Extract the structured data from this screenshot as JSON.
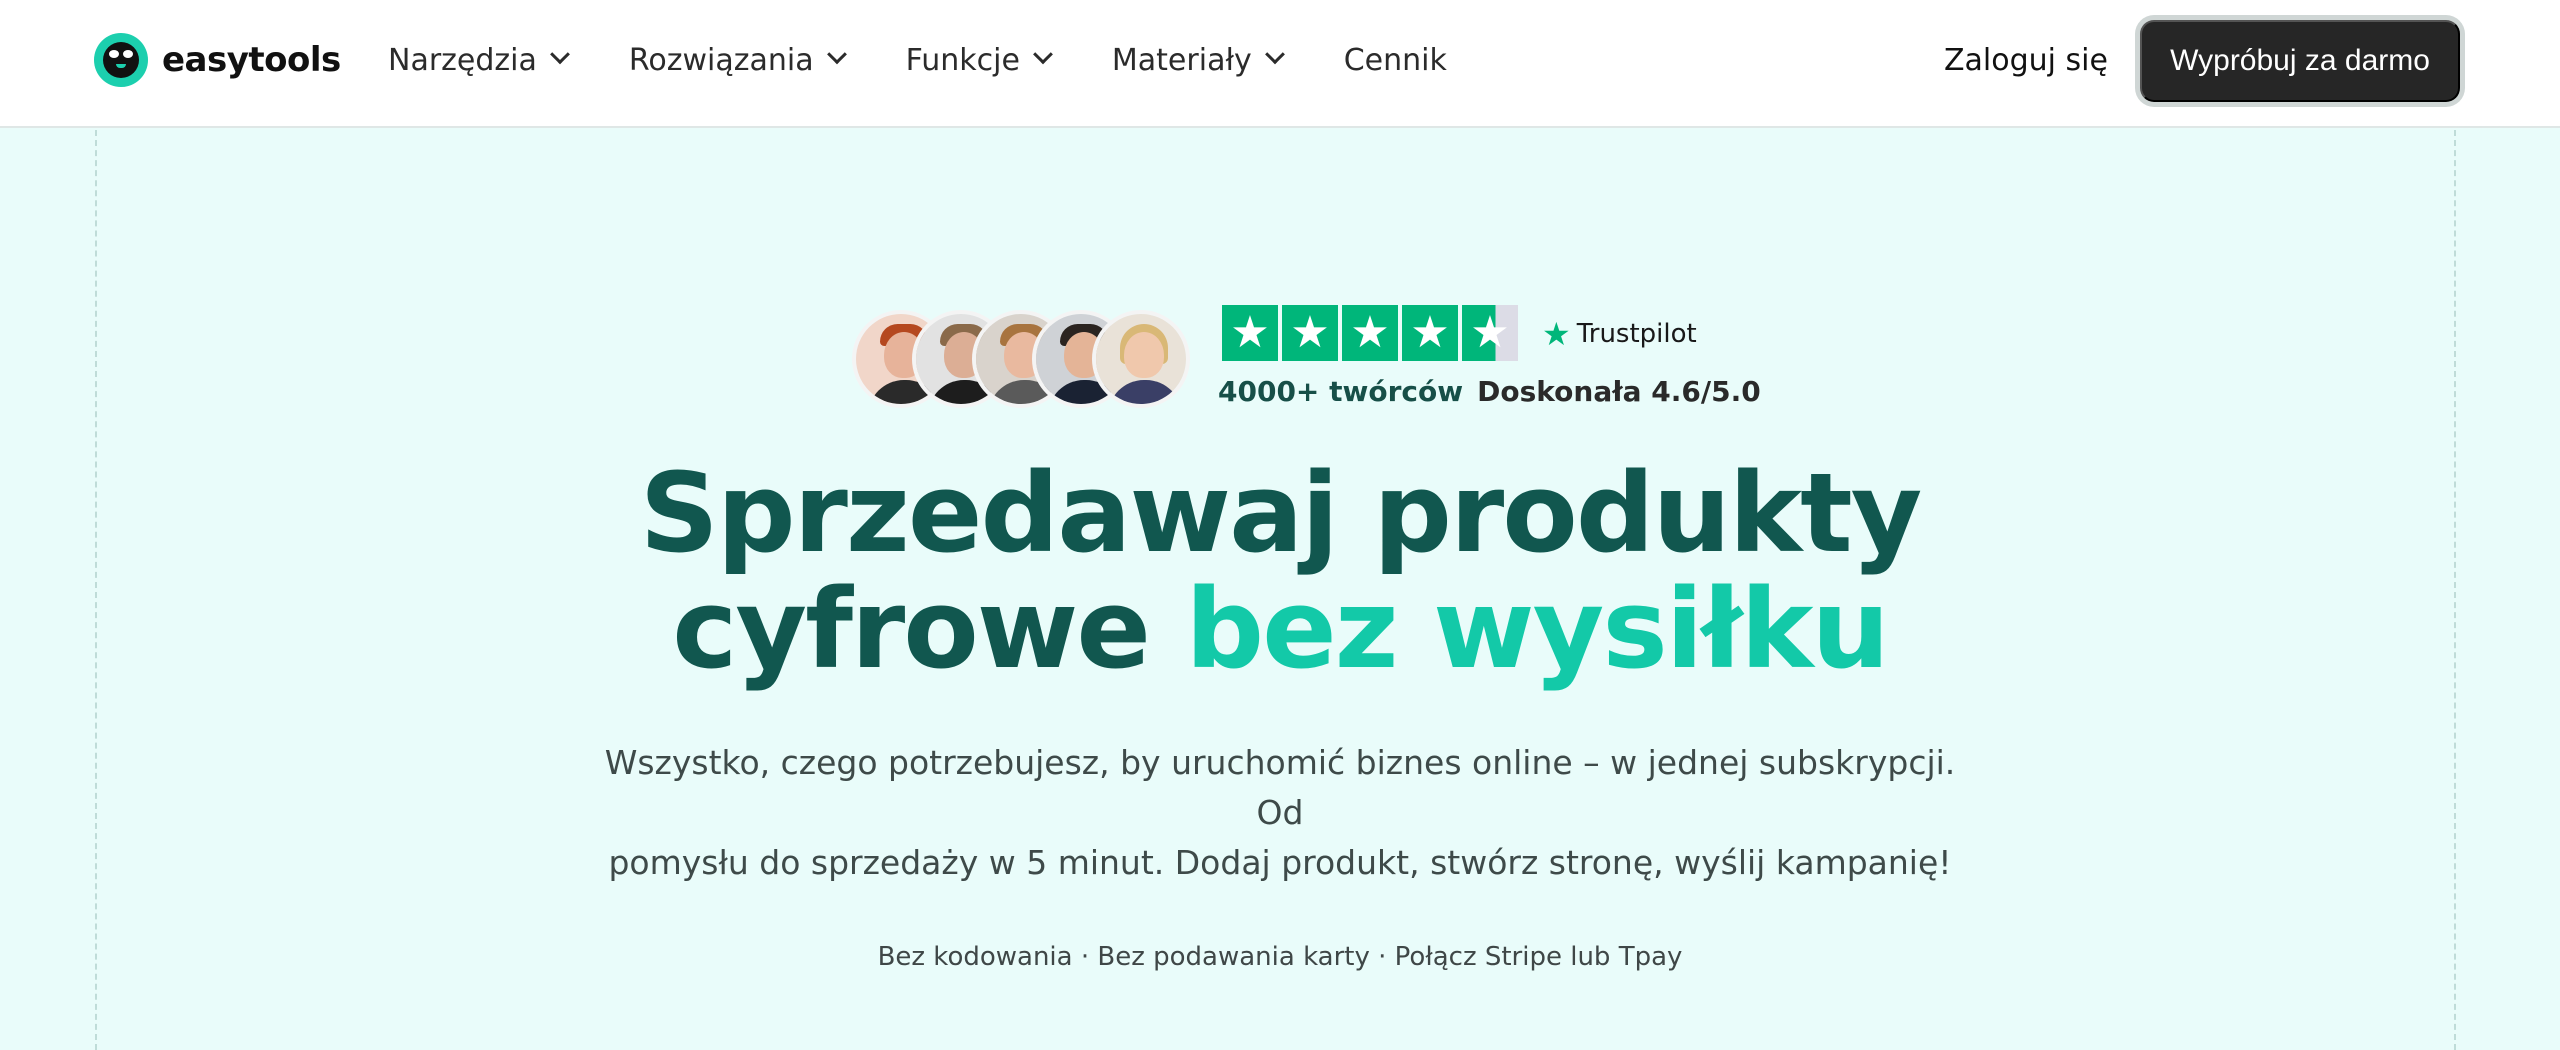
{
  "brand": {
    "name": "easytools"
  },
  "nav": {
    "items": [
      {
        "label": "Narzędzia",
        "has_dropdown": true
      },
      {
        "label": "Rozwiązania",
        "has_dropdown": true
      },
      {
        "label": "Funkcje",
        "has_dropdown": true
      },
      {
        "label": "Materiały",
        "has_dropdown": true
      },
      {
        "label": "Cennik",
        "has_dropdown": false
      }
    ],
    "login_label": "Zaloguj się",
    "cta_label": "Wypróbuj za darmo"
  },
  "proof": {
    "avatar_count": 5,
    "star_rating": 4.6,
    "star_max": 5,
    "trustpilot_label": "Trustpilot",
    "creators_text": "4000+ twórców",
    "rating_text": "Doskonała 4.6/5.0"
  },
  "hero": {
    "headline_line1": "Sprzedawaj produkty",
    "headline_line2_plain": "cyfrowe",
    "headline_line2_accent": "bez wysiłku",
    "subtitle_line1": "Wszystko, czego potrzebujesz, by uruchomić biznes online – w jednej subskrypcji. Od",
    "subtitle_line2": "pomysłu do sprzedaży w 5 minut. Dodaj produkt, stwórz stronę, wyślij kampanię!",
    "note": "Bez kodowania · Bez podawania karty · Połącz Stripe lub Tpay"
  },
  "colors": {
    "accent": "#13c9a8",
    "headline": "#11574f",
    "background": "#e9fcfa",
    "trustpilot_green": "#00b67a",
    "cta_background": "#262626"
  },
  "icons": [
    "logo-mark",
    "chevron-down-icon",
    "star-icon",
    "trustpilot-star-icon"
  ]
}
